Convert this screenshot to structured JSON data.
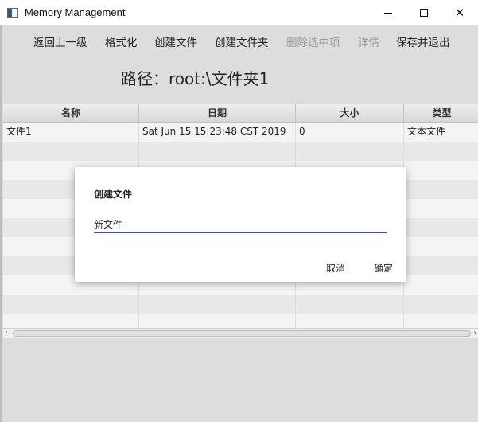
{
  "window": {
    "title": "Memory Management",
    "icon": "app-window-icon",
    "minimize_label": "–",
    "close_label": "✕"
  },
  "toolbar": {
    "back": "返回上一级",
    "format": "格式化",
    "create_file": "创建文件",
    "create_folder": "创建文件夹",
    "delete_selected": "删除选中项",
    "details": "详情",
    "save_exit": "保存并退出"
  },
  "path_label": "路径：root:\\文件夹1",
  "table": {
    "columns": [
      "名称",
      "日期",
      "大小",
      "类型"
    ],
    "rows": [
      [
        "文件1",
        "Sat Jun 15 15:23:48 CST 2019",
        "0",
        "文本文件"
      ]
    ]
  },
  "scrollbar": {
    "left_arrow": "‹",
    "right_arrow": "›"
  },
  "dialog": {
    "title": "创建文件",
    "input_value": "新文件",
    "cancel": "取消",
    "ok": "确定"
  },
  "colors": {
    "accent": "#3f51b5",
    "app_bg": "#dddddd",
    "disabled_text": "#9a9a9a"
  }
}
